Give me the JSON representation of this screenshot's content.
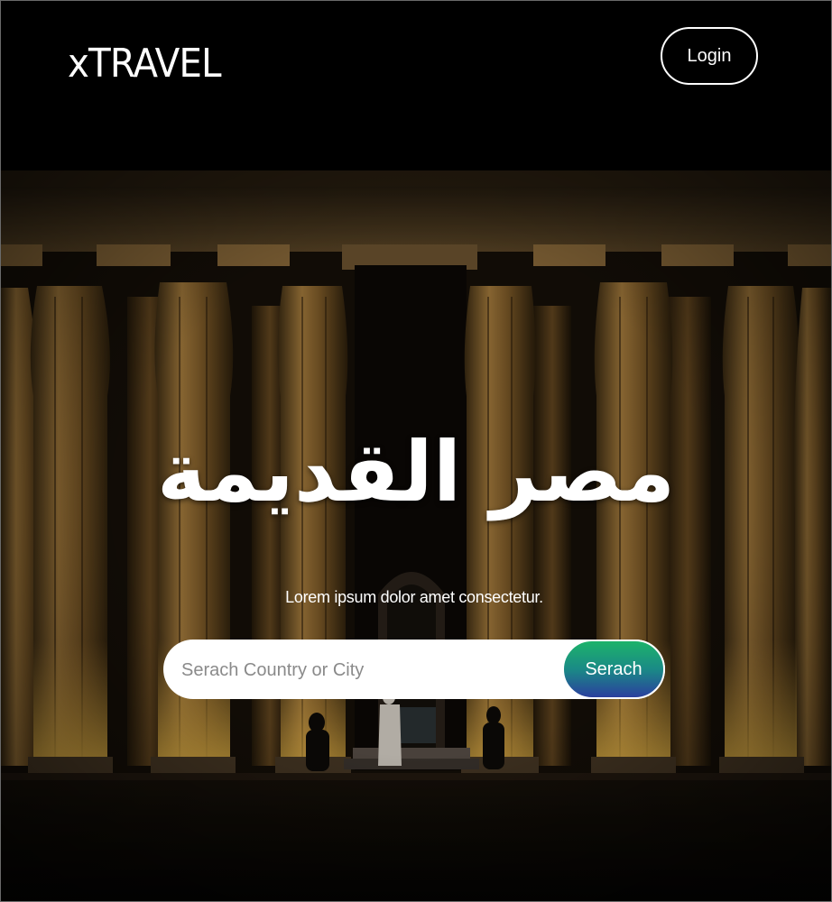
{
  "header": {
    "logo_text": "xTRAVEL",
    "login_label": "Login"
  },
  "hero": {
    "title": "مصر القديمة",
    "subtitle": "Lorem ipsum dolor amet consectetur.",
    "search": {
      "placeholder": "Serach Country or City",
      "value": "",
      "button_label": "Serach"
    }
  },
  "colors": {
    "background": "#000000",
    "search_button_gradient": [
      "#1db36a",
      "#2b3f9e"
    ],
    "text": "#ffffff"
  },
  "icons": []
}
